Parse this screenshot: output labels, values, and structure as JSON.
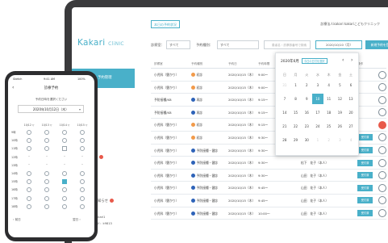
{
  "laptop": {
    "top_link": "本日の予約状況",
    "account": "診療法人kakari kakariこどもクリニック",
    "logo_main": "Kakari",
    "logo_suffix": "CliNIC",
    "sidebar": {
      "items": [
        {
          "label": "予約管理",
          "active": true
        },
        {
          "label": "ンター",
          "active": false
        },
        {
          "label": "うつ診療者",
          "active": false,
          "badge": true
        },
        {
          "label": "ニックPR",
          "active": false
        },
        {
          "label": "雨からのお知らせ",
          "active": false,
          "badge": true
        },
        {
          "label": "ニックID：kakari1",
          "active": false
        },
        {
          "label": "ュリティコード：k9813",
          "active": false
        }
      ]
    },
    "filters": {
      "doctor_label": "診察室：",
      "doctor_value": "すべて",
      "type_label": "予約種別：",
      "type_value": "すべて",
      "search_placeholder": "患者名・診察券番号で検索",
      "date_value": "2020/10/10（月）",
      "new_button": "新規予約を登録"
    },
    "table": {
      "headers": [
        "診察室",
        "予約種別",
        "予約日",
        "予約時間",
        "患者名",
        "操作"
      ],
      "rows": [
        {
          "name": "小児科（肇かり）",
          "status": "初診",
          "status_color": "#f29a4a",
          "date": "2020/10/15（木）",
          "time": "9:00〜",
          "patient": "",
          "action": "",
          "chat_red": false
        },
        {
          "name": "小児科（肇かり）",
          "status": "初診",
          "status_color": "#f29a4a",
          "date": "2020/10/15（木）",
          "time": "9:00〜",
          "patient": "",
          "action": "",
          "chat_red": false
        },
        {
          "name": "予防接種/KB",
          "status": "再診",
          "status_color": "#2e63b8",
          "date": "2020/10/15（木）",
          "time": "9:15〜",
          "patient": "",
          "action": "",
          "chat_red": false
        },
        {
          "name": "予防接種/KB",
          "status": "再診",
          "status_color": "#2e63b8",
          "date": "2020/10/15（木）",
          "time": "9:15〜",
          "patient": "",
          "action": "",
          "chat_red": false
        },
        {
          "name": "小児科（肇かり）",
          "status": "初診",
          "status_color": "#f29a4a",
          "date": "2020/10/15（木）",
          "time": "9:15〜",
          "patient": "",
          "action": "",
          "chat_red": true
        },
        {
          "name": "小児科（肇かり）",
          "status": "初診",
          "status_color": "#f29a4a",
          "date": "2020/10/15（木）",
          "time": "9:30〜",
          "patient": "岡本　二郎（本人）",
          "action": "受付済",
          "chat_red": false
        },
        {
          "name": "小児科（肇かり）",
          "status": "予防接種・健診",
          "status_color": "#2e63b8",
          "date": "2020/10/15（木）",
          "time": "9:30〜",
          "patient": "山田　花子（本人）",
          "action": "受付済",
          "chat_red": false
        },
        {
          "name": "小児科（肇かり）",
          "status": "予防接種・健診",
          "status_color": "#2e63b8",
          "date": "2020/10/15（木）",
          "time": "9:30〜",
          "patient": "松下　花子（本人）",
          "action": "受付済",
          "chat_red": false
        },
        {
          "name": "小児科（肇かり）",
          "status": "予防接種・健診",
          "status_color": "#2e63b8",
          "date": "2020/10/15（木）",
          "time": "9:30〜",
          "patient": "山田　花子（本人）",
          "action": "受付済",
          "chat_red": false
        },
        {
          "name": "小児科（肇かり）",
          "status": "予防接種・健診",
          "status_color": "#2e63b8",
          "date": "2020/10/15（木）",
          "time": "9:45〜",
          "patient": "山田　花子（本人）",
          "action": "受付済",
          "chat_red": false
        },
        {
          "name": "小児科（肇かり）",
          "status": "予防接種・健診",
          "status_color": "#2e63b8",
          "date": "2020/10/15（木）",
          "time": "9:45〜",
          "patient": "山田　花子（本人）",
          "action": "受付済",
          "chat_red": false
        },
        {
          "name": "小児科（肇かり）",
          "status": "予防接種・健診",
          "status_color": "#2e63b8",
          "date": "2020/10/15（木）",
          "time": "10:00〜",
          "patient": "山田　花子（本人）",
          "action": "受付済",
          "chat_red": false
        }
      ]
    },
    "calendar": {
      "month": "2020年6月",
      "today_button": "今日の日付を選択",
      "prev": "‹",
      "next": "›",
      "weekdays": [
        "日",
        "月",
        "火",
        "水",
        "木",
        "金",
        "土"
      ],
      "weeks": [
        [
          "31",
          "1",
          "2",
          "3",
          "4",
          "5",
          "6"
        ],
        [
          "7",
          "8",
          "9",
          "10",
          "11",
          "12",
          "13"
        ],
        [
          "14",
          "15",
          "16",
          "17",
          "18",
          "19",
          "20"
        ],
        [
          "21",
          "22",
          "23",
          "24",
          "25",
          "26",
          "27"
        ],
        [
          "28",
          "29",
          "30",
          "1",
          "2",
          "3",
          "4"
        ]
      ],
      "selected": "10"
    }
  },
  "phone": {
    "carrier": "Sketch",
    "time": "9:41 AM",
    "battery": "100%",
    "title": "診療予約",
    "subtitle": "予約日時を選択ください",
    "date": "2020年10月12日（木）",
    "columns": [
      "10/12 ▽",
      "10/13 ▽",
      "10/14 ▽",
      "10/15 ▽"
    ],
    "hours": [
      "9時",
      "10時",
      "11時",
      "12時",
      "13時",
      "14時",
      "15時",
      "16時",
      "17時",
      "18時"
    ],
    "prev_link": "‹ 前日",
    "next_link": "翌日 ›"
  },
  "colors": {
    "accent": "#49b0c9",
    "alert": "#e8594a",
    "first_visit": "#f29a4a",
    "revisit": "#2e63b8"
  }
}
